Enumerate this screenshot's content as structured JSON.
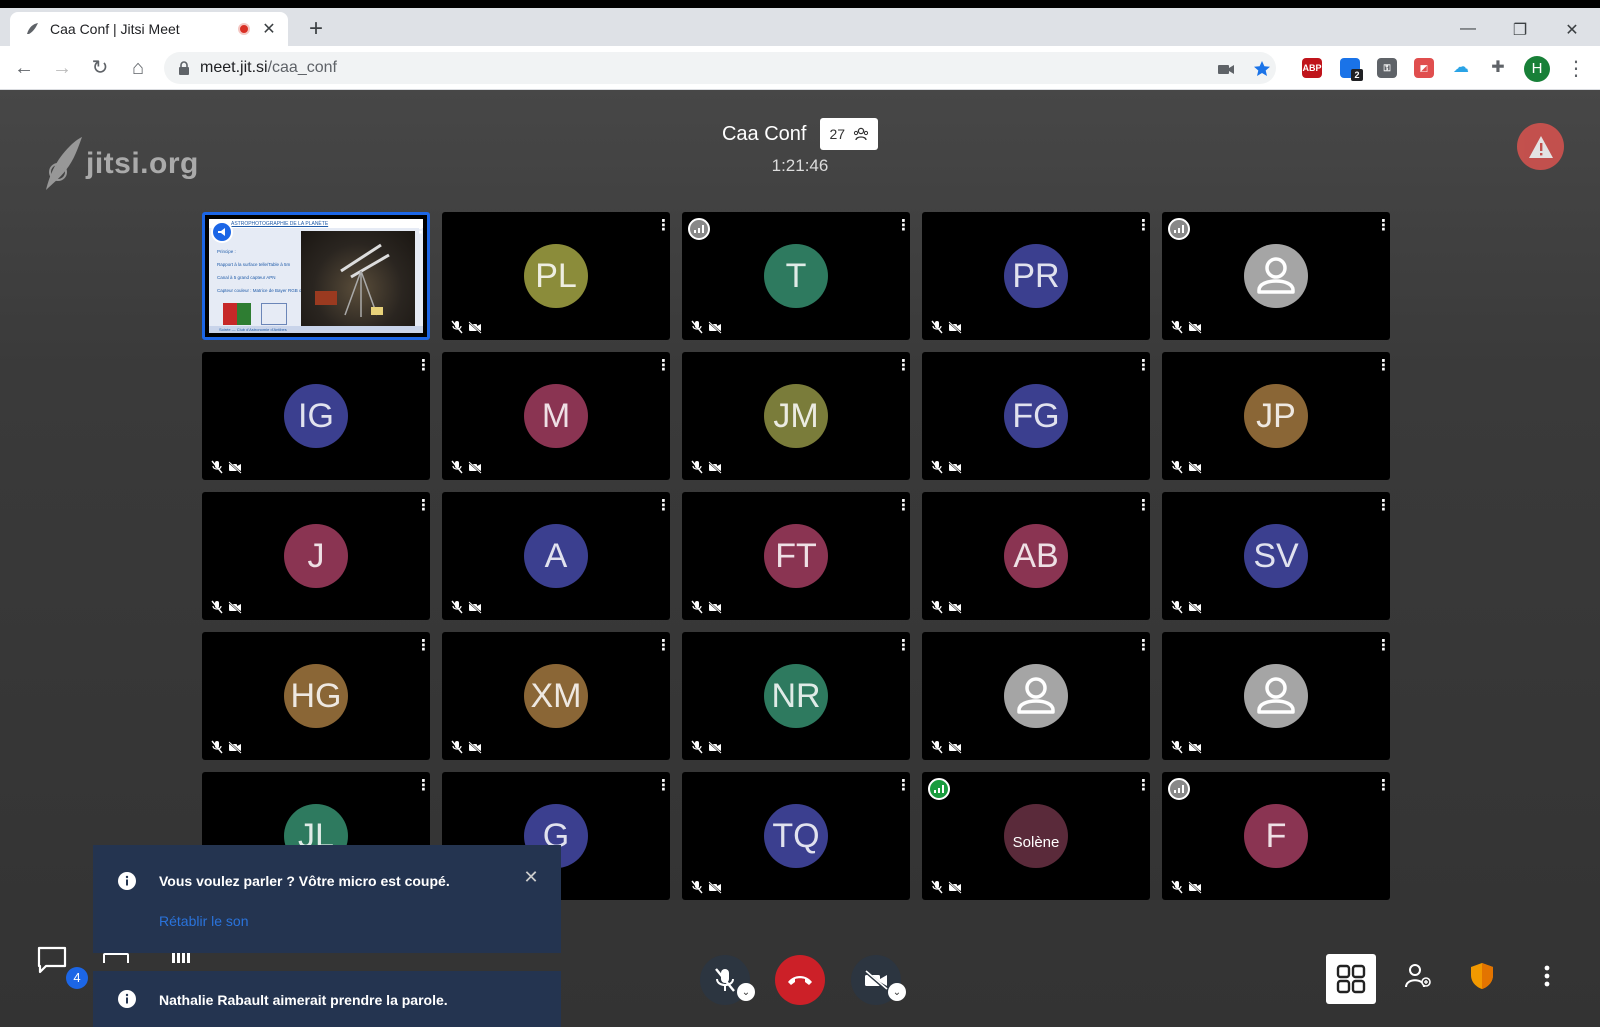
{
  "browser": {
    "tab_title": "Caa Conf | Jitsi Meet",
    "url_host": "meet.jit.si",
    "url_path": "/caa_conf",
    "profile_initial": "H",
    "ext_abp": "ABP",
    "ext_badge": "2"
  },
  "jitsi": {
    "watermark": "jitsi.org",
    "conference_title": "Caa Conf",
    "participant_count": "27",
    "timer": "1:21:46"
  },
  "tiles": [
    {
      "kind": "screen",
      "active": true
    },
    {
      "initials": "PL",
      "color": "#8b8c3a"
    },
    {
      "initials": "T",
      "color": "#2e7a5f",
      "conn": "grey"
    },
    {
      "initials": "PR",
      "color": "#3b3f8f"
    },
    {
      "initials": "",
      "color": "default",
      "conn": "grey"
    },
    {
      "initials": "IG",
      "color": "#3b3f8f"
    },
    {
      "initials": "M",
      "color": "#8a3452"
    },
    {
      "initials": "JM",
      "color": "#7a7c3a"
    },
    {
      "initials": "FG",
      "color": "#3b3f8f"
    },
    {
      "initials": "JP",
      "color": "#8a6636"
    },
    {
      "initials": "J",
      "color": "#8a3452"
    },
    {
      "initials": "A",
      "color": "#3b3f8f"
    },
    {
      "initials": "FT",
      "color": "#8a3452"
    },
    {
      "initials": "AB",
      "color": "#8a3452"
    },
    {
      "initials": "SV",
      "color": "#3b3f8f"
    },
    {
      "initials": "HG",
      "color": "#8a6636"
    },
    {
      "initials": "XM",
      "color": "#8a6636"
    },
    {
      "initials": "NR",
      "color": "#2e7a5f"
    },
    {
      "initials": "",
      "color": "default"
    },
    {
      "initials": "",
      "color": "default"
    },
    {
      "initials": "JL",
      "color": "#2e7a5f"
    },
    {
      "initials": "G",
      "color": "#3b3f8f"
    },
    {
      "initials": "TQ",
      "color": "#3b3f8f"
    },
    {
      "initials": "",
      "color": "#5a2a3a",
      "name": "Solène",
      "conn": "good"
    },
    {
      "initials": "F",
      "color": "#8a3452",
      "conn": "grey"
    }
  ],
  "shared_screen": {
    "heading": "ASTROPHOTOGRAPHIE DE LA PLANÈTE",
    "lines": [
      "Principe :",
      "Rapport à la surface telle/Table à 5m",
      "Canal à 5 grand capteur APN",
      "Capteur couleur : Matrice de Bayer RGB ou \"Dual Bayer\""
    ],
    "footer": "Soirée — Club d'Astronomie d'Antibes"
  },
  "notifications": {
    "mic_muted": {
      "text": "Vous voulez parler ? Vôtre micro est coupé.",
      "action": "Rétablir le son"
    },
    "raise_hand": {
      "text": "Nathalie Rabault aimerait prendre la parole."
    }
  },
  "toolbar": {
    "chat_badge": "4"
  },
  "colors": {
    "accent": "#1c66e6",
    "hangup": "#cc2028",
    "notification_bg": "#243450",
    "warning": "#d9534f"
  }
}
